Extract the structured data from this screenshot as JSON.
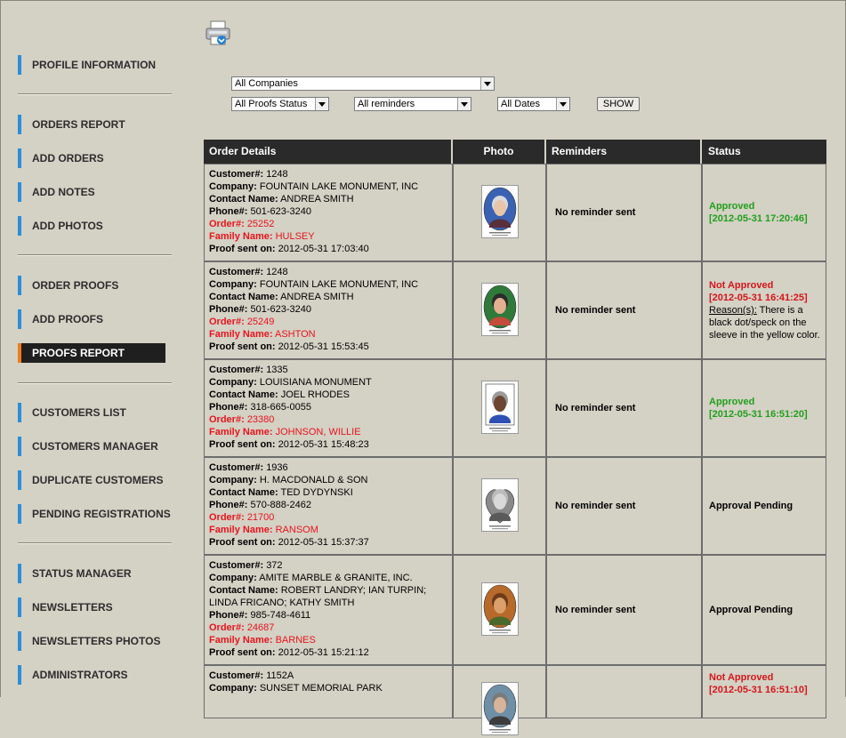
{
  "sidebar": {
    "items": [
      {
        "label": "PROFILE INFORMATION"
      },
      {
        "label": "ORDERS REPORT"
      },
      {
        "label": "ADD ORDERS"
      },
      {
        "label": "ADD NOTES"
      },
      {
        "label": "ADD PHOTOS"
      },
      {
        "label": "ORDER PROOFS"
      },
      {
        "label": "ADD PROOFS"
      },
      {
        "label": "PROOFS REPORT"
      },
      {
        "label": "CUSTOMERS LIST"
      },
      {
        "label": "CUSTOMERS MANAGER"
      },
      {
        "label": "DUPLICATE CUSTOMERS"
      },
      {
        "label": "PENDING REGISTRATIONS"
      },
      {
        "label": "STATUS MANAGER"
      },
      {
        "label": "NEWSLETTERS"
      },
      {
        "label": "NEWSLETTERS PHOTOS"
      },
      {
        "label": "ADMINISTRATORS"
      }
    ],
    "active_index": 7,
    "accent_color": "#2a8fd8",
    "active_accent_color": "#f07c1e"
  },
  "toolbar": {
    "print_icon": "printer-icon"
  },
  "filters": {
    "company": "All Companies",
    "proofs_status": "All Proofs Status",
    "reminders": "All reminders",
    "dates": "All Dates",
    "show_label": "SHOW"
  },
  "table": {
    "headers": [
      "Order Details",
      "Photo",
      "Reminders",
      "Status"
    ],
    "field_labels": {
      "customer": "Customer#:",
      "company": "Company:",
      "contact": "Contact Name:",
      "phone": "Phone#:",
      "order": "Order#:",
      "family": "Family Name:",
      "proof_sent": "Proof sent on:",
      "reason": "Reason(s):"
    },
    "rows": [
      {
        "customer": "1248",
        "company": "FOUNTAIN LAKE MONUMENT, INC",
        "contact": "ANDREA SMITH",
        "phone": "501-623-3240",
        "order": "25252",
        "family": "HULSEY",
        "proof_sent": "2012-05-31 17:03:40",
        "reminder": "No reminder sent",
        "status": "Approved",
        "status_date": "[2012-05-31 17:20:46]"
      },
      {
        "customer": "1248",
        "company": "FOUNTAIN LAKE MONUMENT, INC",
        "contact": "ANDREA SMITH",
        "phone": "501-623-3240",
        "order": "25249",
        "family": "ASHTON",
        "proof_sent": "2012-05-31 15:53:45",
        "reminder": "No reminder sent",
        "status": "Not Approved",
        "status_date": "[2012-05-31 16:41:25]",
        "reason": "There is a black dot/speck on the sleeve in the yellow color."
      },
      {
        "customer": "1335",
        "company": "LOUISIANA MONUMENT",
        "contact": "JOEL RHODES",
        "phone": "318-665-0055",
        "order": "23380",
        "family": "JOHNSON, WILLIE",
        "proof_sent": "2012-05-31 15:48:23",
        "reminder": "No reminder sent",
        "status": "Approved",
        "status_date": "[2012-05-31 16:51:20]"
      },
      {
        "customer": "1936",
        "company": "H. MACDONALD & SON",
        "contact": "TED DYDYNSKI",
        "phone": "570-888-2462",
        "order": "21700",
        "family": "RANSOM",
        "proof_sent": "2012-05-31 15:37:37",
        "reminder": "No reminder sent",
        "status": "Approval Pending"
      },
      {
        "customer": "372",
        "company": "AMITE MARBLE & GRANITE, INC.",
        "contact": "ROBERT LANDRY; IAN TURPIN; LINDA FRICANO; KATHY SMITH",
        "phone": "985-748-4611",
        "order": "24687",
        "family": "BARNES",
        "proof_sent": "2012-05-31 15:21:12",
        "reminder": "No reminder sent",
        "status": "Approval Pending"
      },
      {
        "customer": "1152A",
        "company": "SUNSET MEMORIAL PARK",
        "status": "Not Approved",
        "status_date": "[2012-05-31 16:51:10]"
      }
    ]
  },
  "colors": {
    "approved": "#21a01c",
    "not_approved": "#d4161a",
    "red_text": "#e8141c",
    "header_bg": "#2a2a2a",
    "page_bg": "#d4d1c5"
  }
}
